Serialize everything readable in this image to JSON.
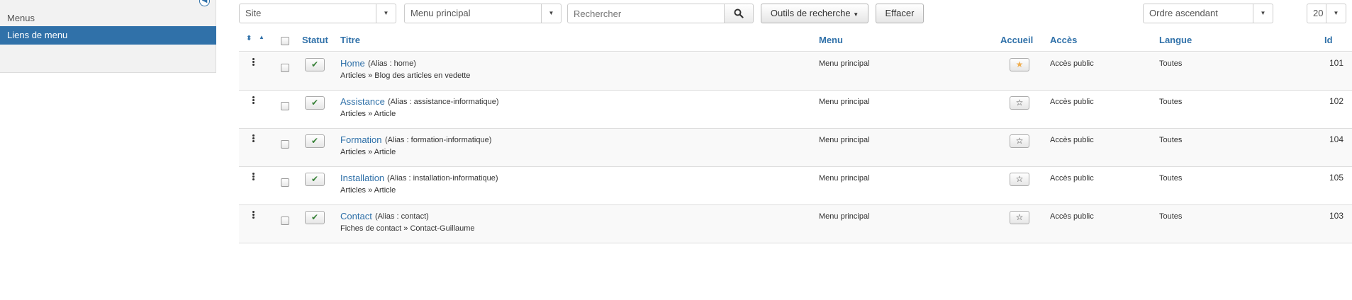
{
  "sidebar": {
    "items": [
      {
        "label": "Menus"
      },
      {
        "label": "Liens de menu"
      }
    ]
  },
  "filters": {
    "client": "Site",
    "menu": "Menu principal",
    "search_placeholder": "Rechercher",
    "tools_label": "Outils de recherche",
    "clear_label": "Effacer",
    "ordering": "Ordre ascendant",
    "limit": "20"
  },
  "table": {
    "headers": {
      "status": "Statut",
      "title": "Titre",
      "menu": "Menu",
      "home": "Accueil",
      "access": "Accès",
      "language": "Langue",
      "id": "Id"
    },
    "rows": [
      {
        "title": "Home",
        "alias": "(Alias : home)",
        "sub": "Articles » Blog des articles en vedette",
        "menu": "Menu principal",
        "home": "★",
        "access": "Accès public",
        "language": "Toutes",
        "id": "101"
      },
      {
        "title": "Assistance",
        "alias": "(Alias : assistance-informatique)",
        "sub": "Articles » Article",
        "menu": "Menu principal",
        "home": "☆",
        "access": "Accès public",
        "language": "Toutes",
        "id": "102"
      },
      {
        "title": "Formation",
        "alias": "(Alias : formation-informatique)",
        "sub": "Articles » Article",
        "menu": "Menu principal",
        "home": "☆",
        "access": "Accès public",
        "language": "Toutes",
        "id": "104"
      },
      {
        "title": "Installation",
        "alias": "(Alias : installation-informatique)",
        "sub": "Articles » Article",
        "menu": "Menu principal",
        "home": "☆",
        "access": "Accès public",
        "language": "Toutes",
        "id": "105"
      },
      {
        "title": "Contact",
        "alias": "(Alias : contact)",
        "sub": "Fiches de contact » Contact-Guillaume",
        "menu": "Menu principal",
        "home": "☆",
        "access": "Accès public",
        "language": "Toutes",
        "id": "103"
      }
    ]
  },
  "icons": {
    "status_published": "✔",
    "sort_both": "⬍",
    "sort_up": "▲",
    "caret": "▼",
    "collapse": "◀"
  },
  "colors": {
    "accent": "#3071a9",
    "published": "#378137",
    "featured": "#f0ad4e"
  }
}
